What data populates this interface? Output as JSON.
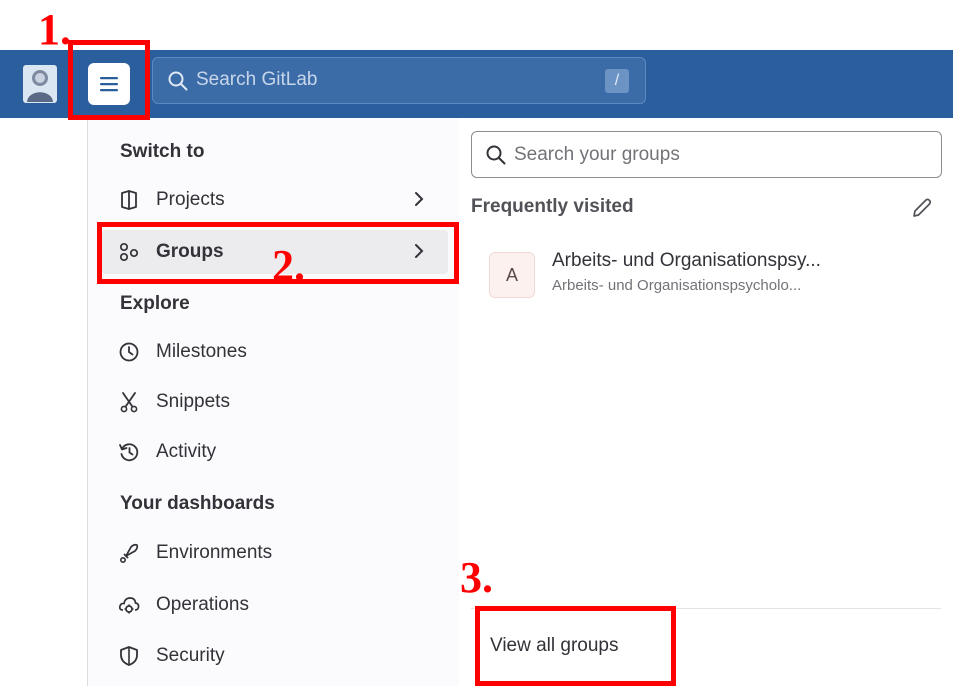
{
  "header": {
    "menu_icon": "hamburger-icon",
    "search_placeholder": "Search GitLab",
    "search_shortcut": "/"
  },
  "sidebar": {
    "sections": {
      "switch_to": "Switch to",
      "explore": "Explore",
      "dashboards": "Your dashboards"
    },
    "switch_items": [
      {
        "label": "Projects",
        "icon": "project-icon"
      },
      {
        "label": "Groups",
        "icon": "group-icon",
        "active": true
      }
    ],
    "explore_items": [
      {
        "label": "Milestones",
        "icon": "clock-icon"
      },
      {
        "label": "Snippets",
        "icon": "scissors-icon"
      },
      {
        "label": "Activity",
        "icon": "history-icon"
      }
    ],
    "dashboard_items": [
      {
        "label": "Environments",
        "icon": "rocket-icon"
      },
      {
        "label": "Operations",
        "icon": "cloud-gear-icon"
      },
      {
        "label": "Security",
        "icon": "shield-icon"
      }
    ]
  },
  "groups_panel": {
    "search_placeholder": "Search your groups",
    "frequently_visited": "Frequently visited",
    "items": [
      {
        "avatar": "A",
        "title": "Arbeits- und Organisationspsy...",
        "subtitle": "Arbeits- und Organisationspsycholo..."
      }
    ],
    "view_all": "View all groups"
  },
  "annotations": {
    "step1": "1.",
    "step2": "2.",
    "step3": "3.",
    "color": "#ff0000"
  },
  "colors": {
    "topbar": "#2b5e9c",
    "sidebar_bg": "#fbfafd"
  }
}
